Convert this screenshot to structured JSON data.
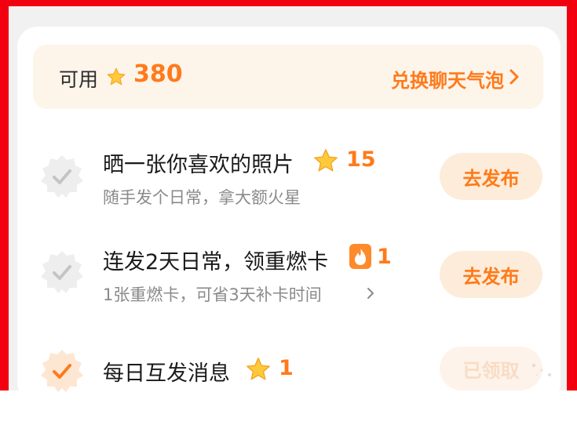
{
  "points": {
    "available_label": "可用",
    "value": "380",
    "redeem_label": "兑换聊天气泡"
  },
  "tasks": [
    {
      "title": "晒一张你喜欢的照片",
      "reward_icon": "star-icon",
      "reward_value": "15",
      "subtitle": "随手发个日常，拿大额火星",
      "button_label": "去发布",
      "completed": false
    },
    {
      "title": "连发2天日常，领重燃卡",
      "reward_icon": "flame-card-icon",
      "reward_value": "1",
      "subtitle": "1张重燃卡，可省3天补卡时间",
      "button_label": "去发布",
      "completed": false
    },
    {
      "title": "每日互发消息",
      "reward_icon": "star-icon",
      "reward_value": "1",
      "subtitle": "",
      "button_label": "已领取",
      "completed": true
    }
  ],
  "colors": {
    "accent": "#ff7a1a",
    "frame_border": "#f2000f",
    "button_bg": "#fdecd9",
    "points_bar_bg": "#fdf4ea"
  }
}
